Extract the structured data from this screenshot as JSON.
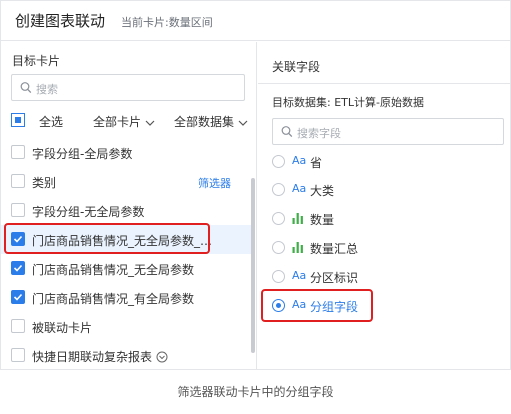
{
  "dialog": {
    "title": "创建图表联动",
    "current_card": "当前卡片:数量区间"
  },
  "left": {
    "heading": "目标卡片",
    "search_placeholder": "搜索",
    "select_all": "全选",
    "card_filter": "全部卡片",
    "dataset_filter": "全部数据集",
    "items": [
      {
        "label": "字段分组-全局参数",
        "checked": false,
        "badge": ""
      },
      {
        "label": "类别",
        "checked": false,
        "badge": "筛选器"
      },
      {
        "label": "字段分组-无全局参数",
        "checked": false,
        "badge": ""
      },
      {
        "label": "门店商品销售情况_无全局参数_…",
        "checked": true,
        "badge": ""
      },
      {
        "label": "门店商品销售情况_无全局参数",
        "checked": true,
        "badge": ""
      },
      {
        "label": "门店商品销售情况_有全局参数",
        "checked": true,
        "badge": ""
      },
      {
        "label": "被联动卡片",
        "checked": false,
        "badge": ""
      },
      {
        "label": "快捷日期联动复杂报表",
        "checked": false,
        "badge": ""
      }
    ]
  },
  "right": {
    "heading": "关联字段",
    "dataset": "目标数据集: ETL计算-原始数据",
    "search_placeholder": "搜索字段",
    "fields": [
      {
        "type": "Aa",
        "name": "省",
        "selected": false
      },
      {
        "type": "Aa",
        "name": "大类",
        "selected": false
      },
      {
        "type": "bar-chart-icon",
        "name": "数量",
        "selected": false
      },
      {
        "type": "bar-chart-icon",
        "name": "数量汇总",
        "selected": false
      },
      {
        "type": "Aa",
        "name": "分区标识",
        "selected": false
      },
      {
        "type": "Aa",
        "name": "分组字段",
        "selected": true
      }
    ]
  },
  "caption": "筛选器联动卡片中的分组字段",
  "colors": {
    "accent": "#2b7de9",
    "highlight_border": "#e02020",
    "measure_green": "#3fae49"
  }
}
